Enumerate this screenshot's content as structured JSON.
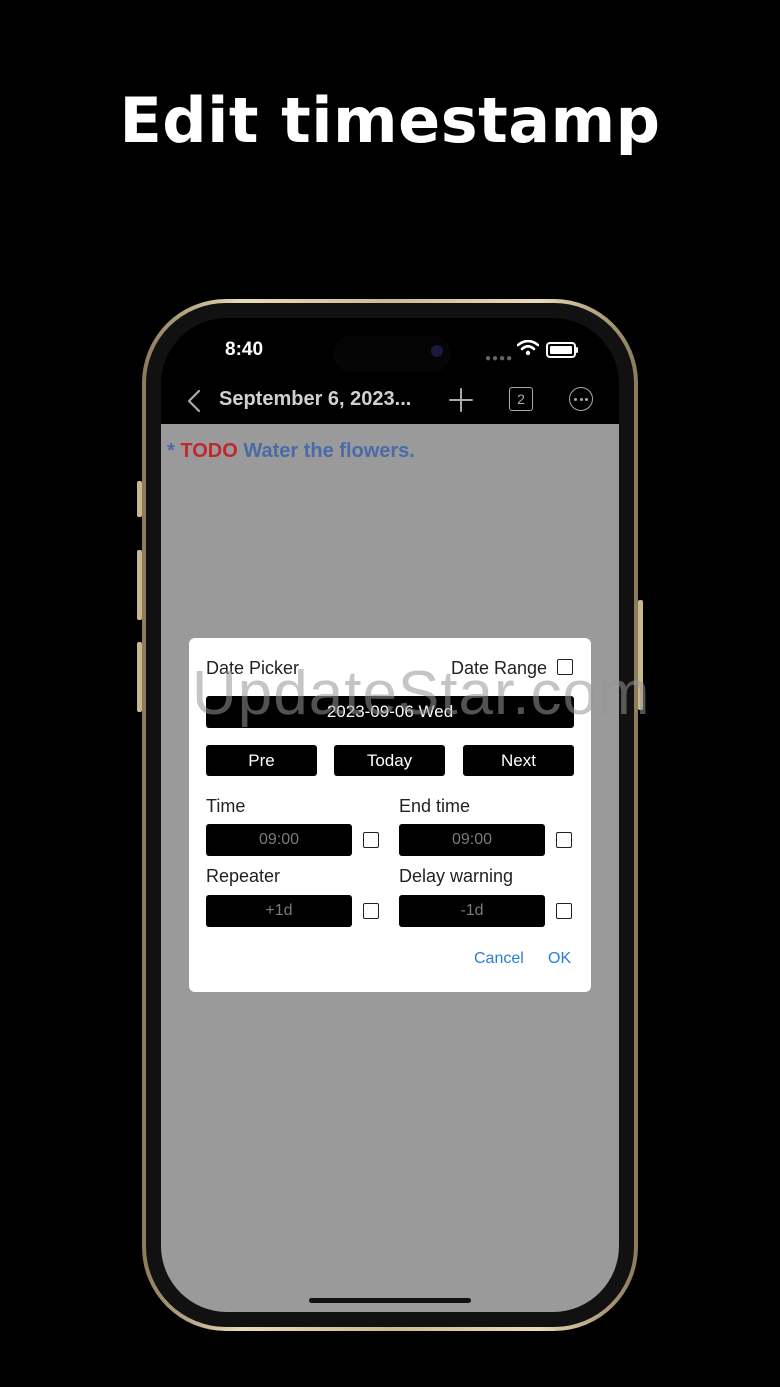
{
  "headline": "Edit timestamp",
  "status": {
    "time": "8:40"
  },
  "navbar": {
    "title": "September 6, 2023...",
    "badge": "2"
  },
  "todo": {
    "star": "*",
    "keyword": "TODO",
    "text": "Water the flowers."
  },
  "dialog": {
    "date_picker_label": "Date Picker",
    "date_range_label": "Date Range",
    "date_value": "2023-09-06 Wed",
    "pre_label": "Pre",
    "today_label": "Today",
    "next_label": "Next",
    "time_label": "Time",
    "time_value": "09:00",
    "end_time_label": "End time",
    "end_time_value": "09:00",
    "repeater_label": "Repeater",
    "repeater_value": "+1d",
    "delay_warning_label": "Delay warning",
    "delay_warning_value": "-1d",
    "cancel_label": "Cancel",
    "ok_label": "OK"
  },
  "watermark": "UpdateStar.com",
  "colors": {
    "todo_keyword": "#c0282e",
    "todo_text": "#4a6aa8",
    "link": "#2a7fd4",
    "content_bg": "#9a9a9a"
  }
}
